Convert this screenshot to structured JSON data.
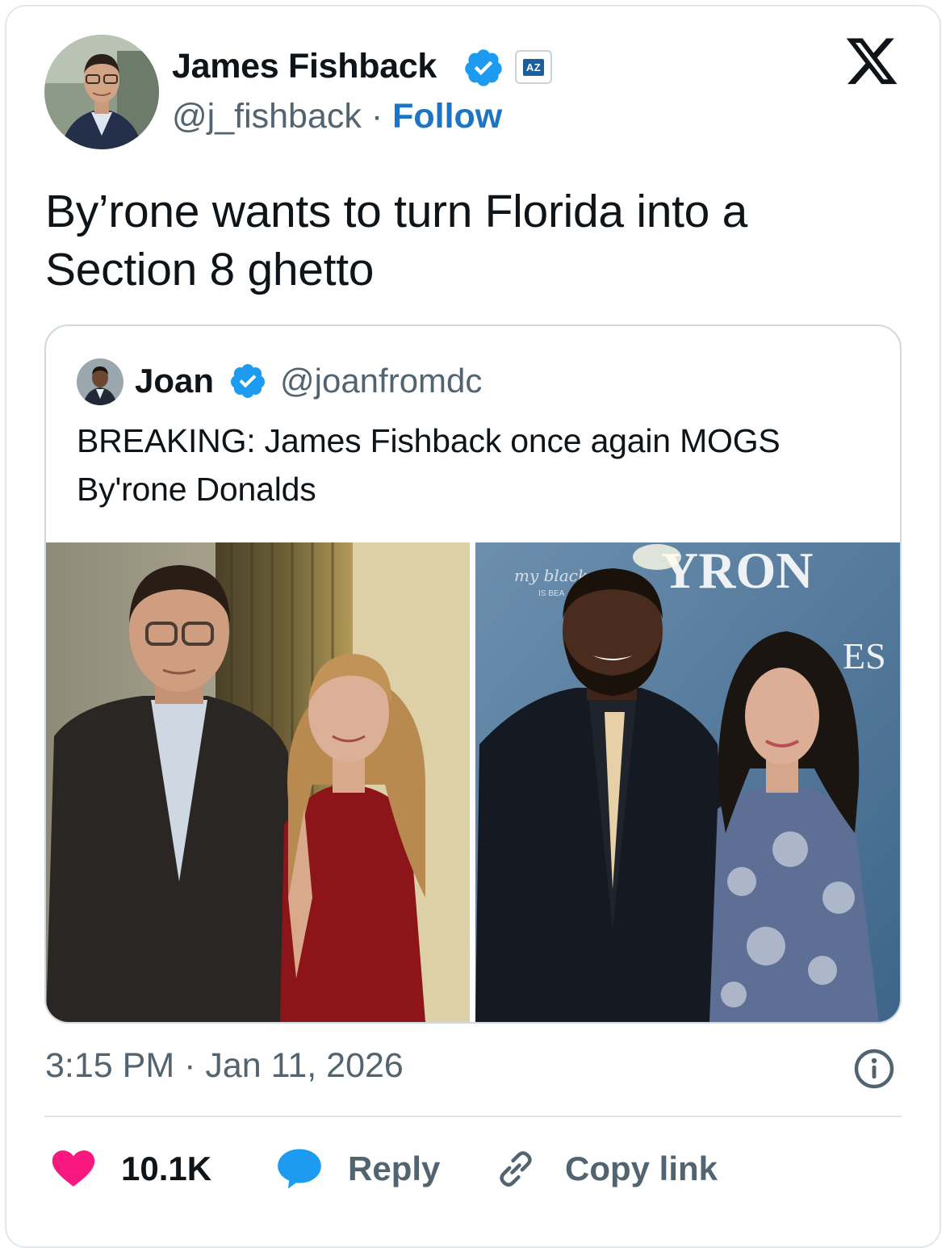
{
  "author": {
    "name": "James Fishback",
    "handle": "@j_fishback",
    "separator": "·",
    "follow_label": "Follow",
    "org_badge_text": "AZ",
    "verified_icon": "verified-badge-icon"
  },
  "platform_logo": "x-logo-icon",
  "tweet": {
    "text": "By’rone wants to turn Florida into a Section 8 ghetto"
  },
  "quoted_tweet": {
    "name": "Joan",
    "handle": "@joanfromdc",
    "text": "BREAKING: James Fishback once again MOGS By'rone Donalds",
    "images": [
      {
        "name": "photo-couple-left"
      },
      {
        "name": "photo-couple-right",
        "backdrop_texts": [
          "my black",
          "IS BEA",
          "YRON",
          "ES"
        ]
      }
    ]
  },
  "meta": {
    "timestamp": "3:15 PM · Jan 11, 2026",
    "info_icon": "info-icon"
  },
  "actions": {
    "like_count": "10.1K",
    "reply_label": "Reply",
    "copy_label": "Copy link"
  },
  "colors": {
    "accent": "#1d74c4",
    "verified": "#1d9bf0",
    "like": "#f91880",
    "muted": "#536471",
    "text": "#0f1419"
  }
}
